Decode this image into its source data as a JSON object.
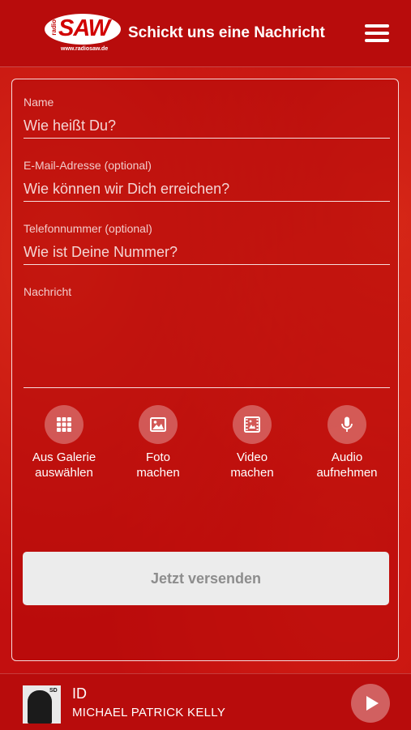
{
  "header": {
    "logo_text": "SAW",
    "logo_radio": "radio",
    "logo_url": "www.radiosaw.de",
    "title": "Schickt uns eine Nachricht",
    "menu_icon": "hamburger-menu-icon"
  },
  "form": {
    "name": {
      "label": "Name",
      "placeholder": "Wie heißt Du?"
    },
    "email": {
      "label": "E-Mail-Adresse (optional)",
      "placeholder": "Wie können wir Dich erreichen?"
    },
    "phone": {
      "label": "Telefonnummer (optional)",
      "placeholder": "Wie ist Deine Nummer?"
    },
    "message": {
      "label": "Nachricht",
      "placeholder": ""
    },
    "actions": [
      {
        "icon": "gallery-grid-icon",
        "line1": "Aus Galerie",
        "line2": "auswählen"
      },
      {
        "icon": "photo-icon",
        "line1": "Foto",
        "line2": "machen"
      },
      {
        "icon": "video-icon",
        "line1": "Video",
        "line2": "machen"
      },
      {
        "icon": "microphone-icon",
        "line1": "Audio",
        "line2": "aufnehmen"
      }
    ],
    "submit_label": "Jetzt versenden"
  },
  "player": {
    "cover_badge": "SD",
    "title": "ID",
    "artist": "MICHAEL PATRICK KELLY",
    "play_icon": "play-icon"
  },
  "colors": {
    "background": "#c40d0d",
    "header": "#b80c0c",
    "submit_bg": "#ececec",
    "submit_text": "#8d8d8d"
  }
}
